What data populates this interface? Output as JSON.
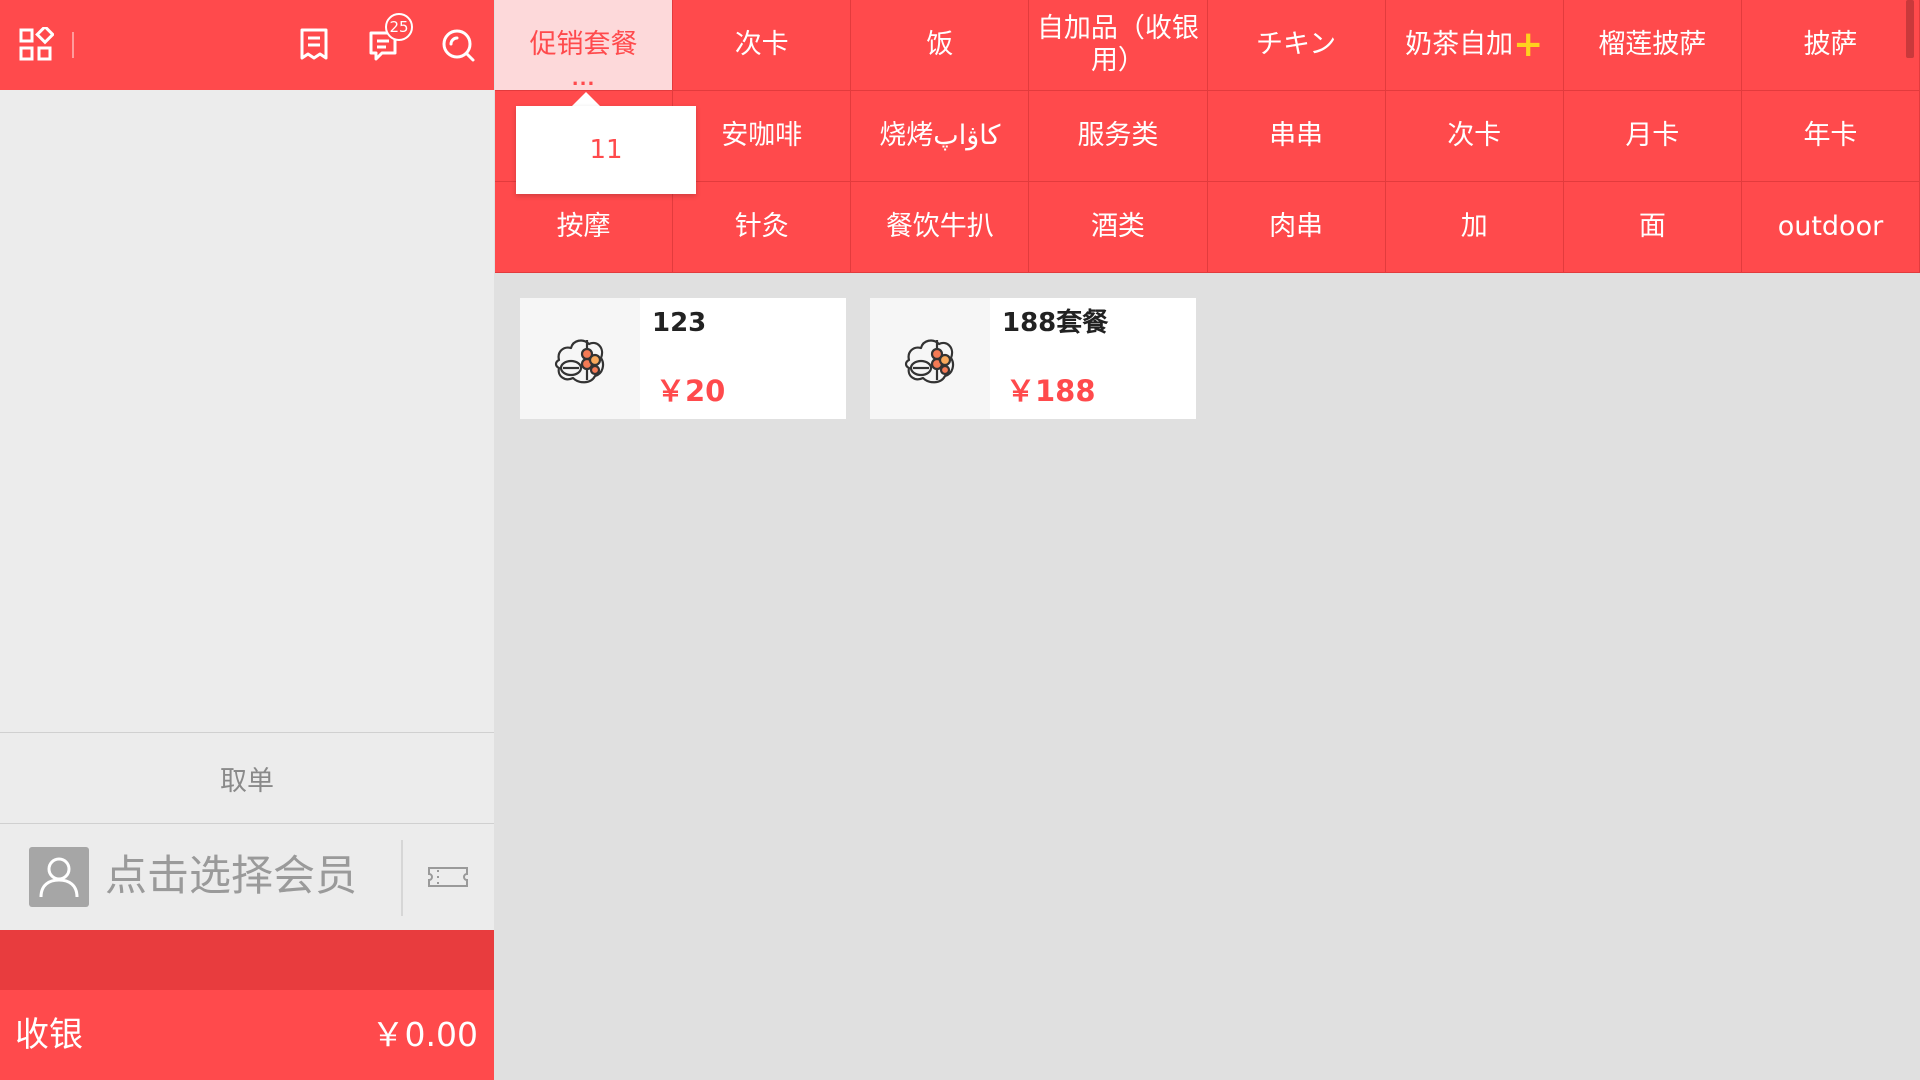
{
  "topbar": {
    "message_badge": "25",
    "icons": [
      "grid-menu-icon",
      "receipt-icon",
      "message-icon",
      "search-icon"
    ]
  },
  "left": {
    "pickup_label": "取单",
    "member_placeholder": "点击选择会员",
    "checkout_label": "收银",
    "checkout_amount": "￥0.00"
  },
  "categories": [
    {
      "label": "促销套餐",
      "active": true,
      "more": "..."
    },
    {
      "label": "次卡"
    },
    {
      "label": "饭"
    },
    {
      "label": "自加品（收银\n用）"
    },
    {
      "label": "チキン"
    },
    {
      "label": "奶茶自加",
      "suffix": "+"
    },
    {
      "label": "榴莲披萨"
    },
    {
      "label": "披萨"
    },
    {
      "label": ""
    },
    {
      "label": "安咖啡"
    },
    {
      "label": "烧烤كاۋاپ"
    },
    {
      "label": "服务类"
    },
    {
      "label": "串串"
    },
    {
      "label": "次卡"
    },
    {
      "label": "月卡"
    },
    {
      "label": "年卡"
    },
    {
      "label": "按摩"
    },
    {
      "label": "针灸"
    },
    {
      "label": "餐饮牛扒"
    },
    {
      "label": "酒类"
    },
    {
      "label": "肉串"
    },
    {
      "label": "加"
    },
    {
      "label": "面"
    },
    {
      "label": "outdoor"
    }
  ],
  "popup": {
    "item": "11"
  },
  "products": [
    {
      "name": "123",
      "price": "￥20",
      "icon": "food-icon"
    },
    {
      "name": "188套餐",
      "price": "￥188",
      "icon": "food-icon"
    }
  ],
  "colors": {
    "primary": "#ff4a4c",
    "primary_dark": "#e83c3e",
    "active_bg": "#fdd9da",
    "accent_plus": "#ffd21e",
    "panel_bg": "#ececec",
    "content_bg": "#e0e0e0"
  }
}
